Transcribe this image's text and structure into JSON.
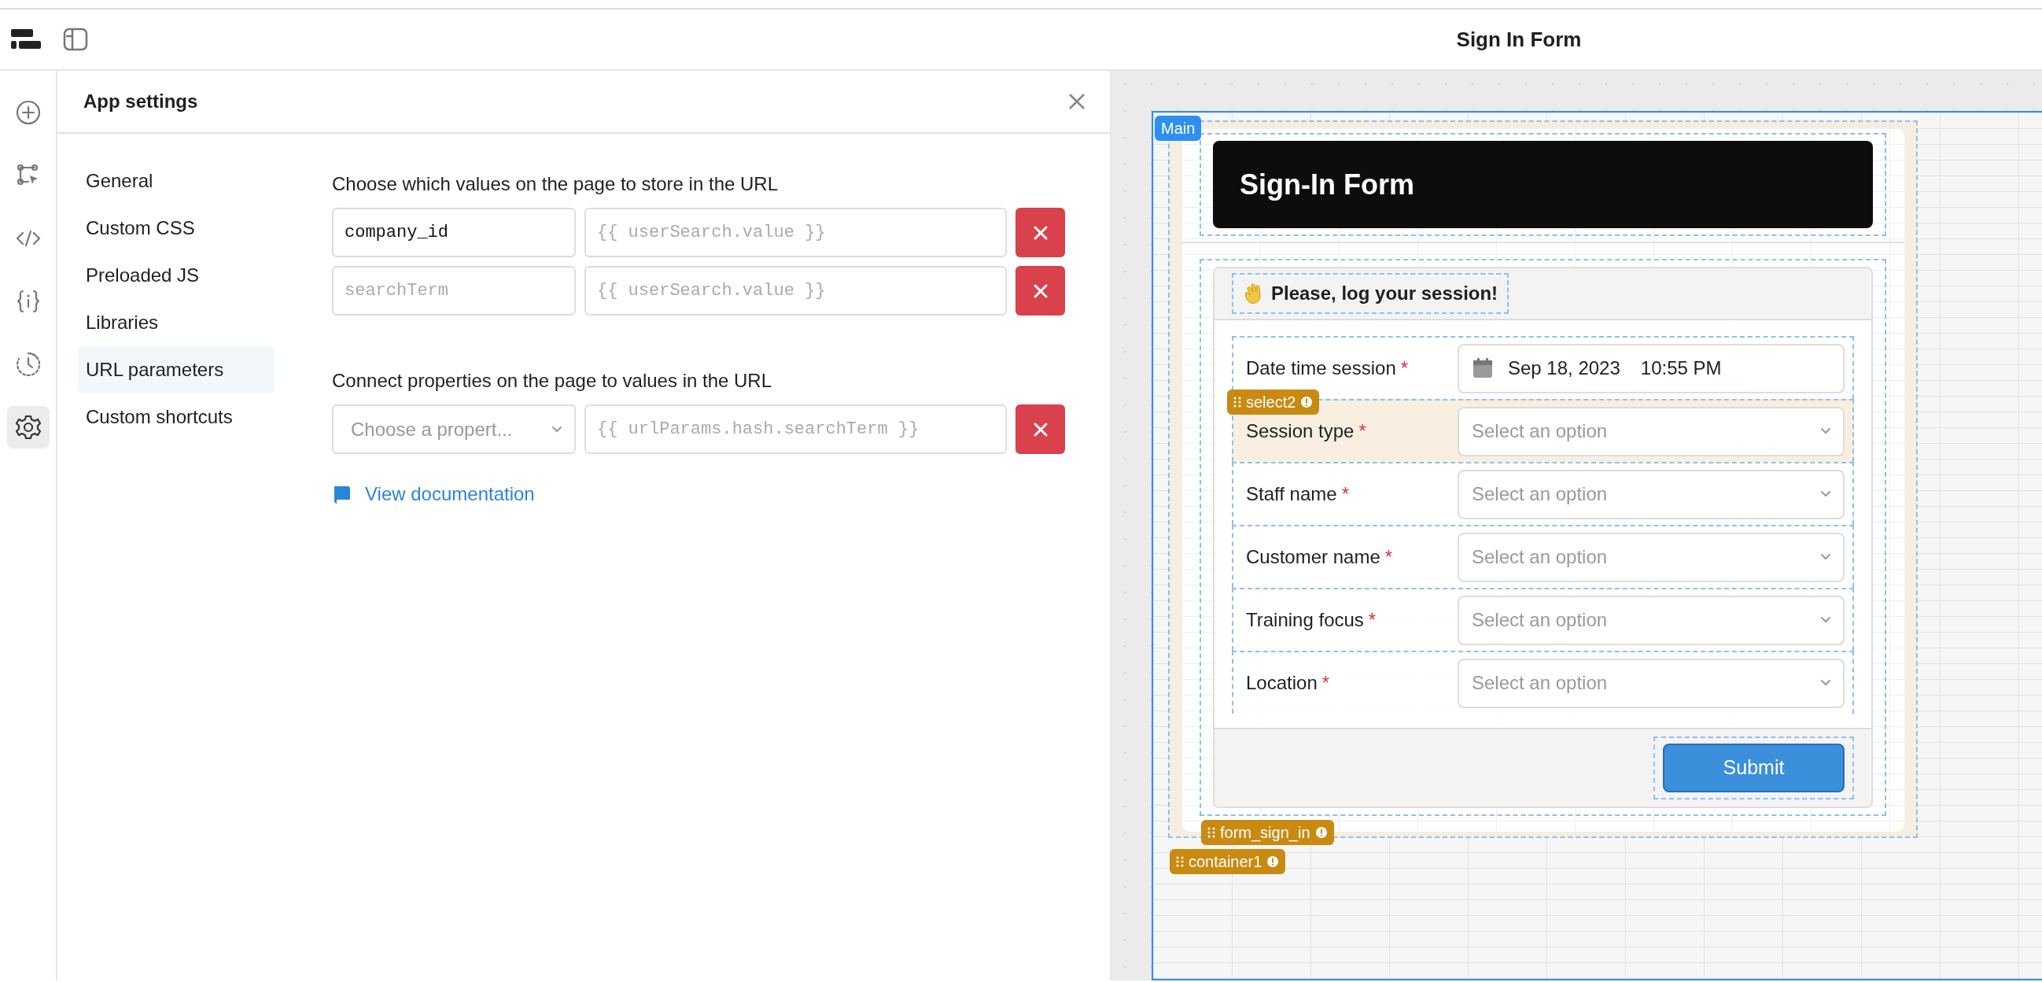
{
  "toolbar": {
    "title": "Sign In Form"
  },
  "rail": [
    {
      "selected": false
    },
    {
      "selected": false
    },
    {
      "selected": false
    },
    {
      "selected": false
    },
    {
      "selected": false
    },
    {
      "selected": true
    }
  ],
  "settings": {
    "title": "App settings",
    "nav": [
      {
        "label": "General",
        "selected": false
      },
      {
        "label": "Custom CSS",
        "selected": false
      },
      {
        "label": "Preloaded JS",
        "selected": false
      },
      {
        "label": "Libraries",
        "selected": false
      },
      {
        "label": "URL parameters",
        "selected": true
      },
      {
        "label": "Custom shortcuts",
        "selected": false
      }
    ],
    "store": {
      "heading": "Choose which values on the page to store in the URL",
      "rows": [
        {
          "key": {
            "value": "company_id"
          },
          "binding": {
            "placeholder": "{{ userSearch.value }}"
          }
        },
        {
          "key": {
            "placeholder": "searchTerm"
          },
          "binding": {
            "placeholder": "{{ userSearch.value }}"
          }
        }
      ]
    },
    "connect": {
      "heading": "Connect properties on the page to values in the URL",
      "rows": [
        {
          "property": {
            "placeholder": "Choose a propert..."
          },
          "binding": {
            "placeholder": "{{ urlParams.hash.searchTerm }}"
          }
        }
      ]
    },
    "doc_link": "View documentation"
  },
  "canvas": {
    "frame_tag": "Main",
    "header_title": "Sign-In Form",
    "form_title": "Please, log your session!",
    "fields": [
      {
        "kind": "datetime",
        "label": "Date time session",
        "required_mark": "*",
        "date": "Sep 18, 2023",
        "time": "10:55 PM",
        "hovered": false
      },
      {
        "kind": "select",
        "label": "Session type",
        "required_mark": "*",
        "placeholder": "Select an option",
        "hovered": true
      },
      {
        "kind": "select",
        "label": "Staff name",
        "required_mark": "*",
        "placeholder": "Select an option",
        "hovered": false
      },
      {
        "kind": "select",
        "label": "Customer name",
        "required_mark": "*",
        "placeholder": "Select an option",
        "hovered": false
      },
      {
        "kind": "select",
        "label": "Training focus",
        "required_mark": "*",
        "placeholder": "Select an option",
        "hovered": false
      },
      {
        "kind": "select",
        "label": "Location",
        "required_mark": "*",
        "placeholder": "Select an option",
        "hovered": false
      }
    ],
    "submit": "Submit",
    "tags": {
      "field": "select2",
      "form": "form_sign_in",
      "container": "container1"
    }
  }
}
